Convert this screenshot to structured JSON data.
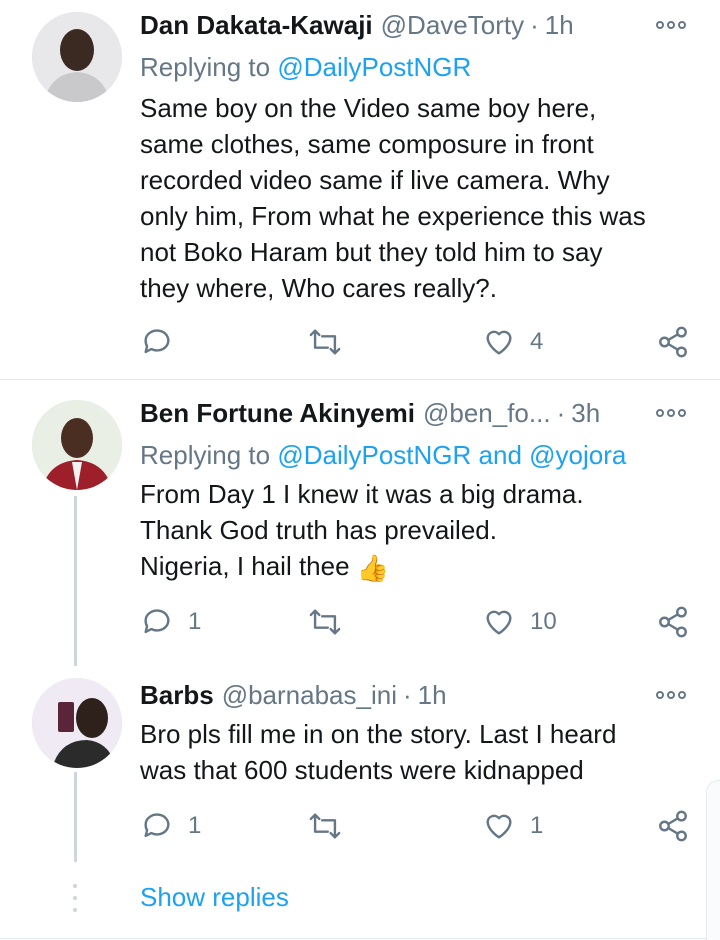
{
  "tweets": [
    {
      "name": "Dan Dakata-Kawaji",
      "handle": "@DaveTorty",
      "time": "1h",
      "replying_prefix": "Replying to",
      "replying_to": "@DailyPostNGR",
      "lines": [
        "Same boy on the Video same boy here,",
        "same clothes, same composure in front",
        "recorded video same if live camera. Why",
        "only him, From what he experience this was",
        "not Boko Haram but they told him to say",
        "they where, Who cares really?."
      ],
      "reply_count": "",
      "retweet_count": "",
      "like_count": "4"
    },
    {
      "name": "Ben Fortune Akinyemi",
      "handle": "@ben_fo...",
      "time": "3h",
      "replying_prefix": "Replying to",
      "replying_to": "@DailyPostNGR and @yojora",
      "lines": [
        "From Day 1 I knew it was a big drama.",
        "Thank God truth has prevailed.",
        "Nigeria, I hail thee"
      ],
      "emoji": "👍",
      "reply_count": "1",
      "retweet_count": "",
      "like_count": "10"
    },
    {
      "name": "Barbs",
      "handle": "@barnabas_ini",
      "time": "1h",
      "lines": [
        "Bro pls fill me in on the story. Last I heard",
        "was that 600 students were kidnapped"
      ],
      "reply_count": "1",
      "retweet_count": "",
      "like_count": "1"
    }
  ],
  "dot_separator": "·",
  "show_replies": "Show replies",
  "colors": {
    "link": "#1da1f2",
    "muted": "#657786",
    "text": "#14171a"
  },
  "icons": [
    "reply-icon",
    "retweet-icon",
    "like-icon",
    "share-icon",
    "more-icon"
  ]
}
